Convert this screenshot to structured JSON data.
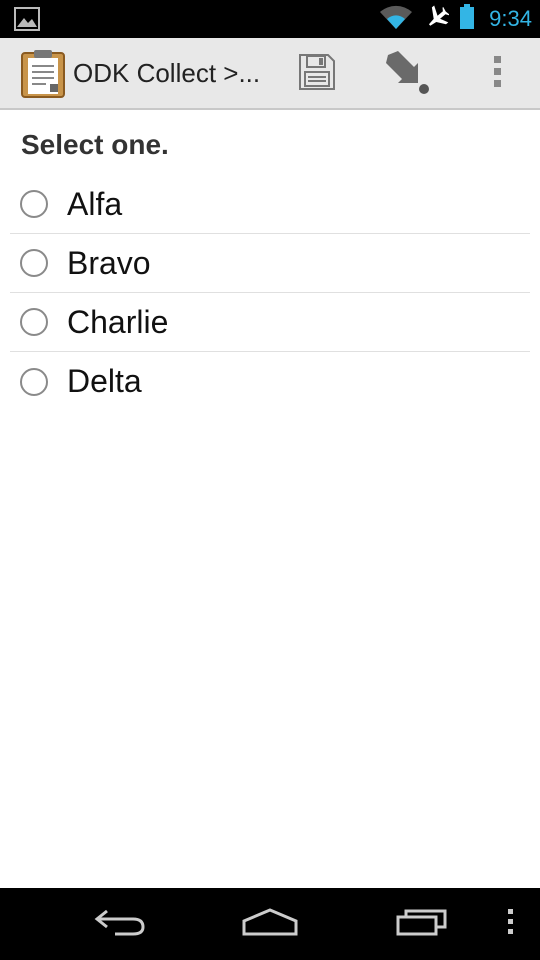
{
  "status_bar": {
    "time": "9:34",
    "icons": [
      "gallery-notification-icon",
      "wifi-icon",
      "airplane-mode-icon",
      "battery-icon"
    ],
    "time_color": "#33b5e5"
  },
  "action_bar": {
    "title": "ODK Collect >...",
    "app_icon": "clipboard-icon",
    "actions": [
      "save-icon",
      "jump-icon",
      "overflow-menu-icon"
    ]
  },
  "question": {
    "prompt": "Select one.",
    "options": [
      {
        "label": "Alfa",
        "selected": false
      },
      {
        "label": "Bravo",
        "selected": false
      },
      {
        "label": "Charlie",
        "selected": false
      },
      {
        "label": "Delta",
        "selected": false
      }
    ]
  },
  "nav_bar": {
    "buttons": [
      "back-icon",
      "home-icon",
      "recent-apps-icon",
      "menu-icon"
    ]
  }
}
